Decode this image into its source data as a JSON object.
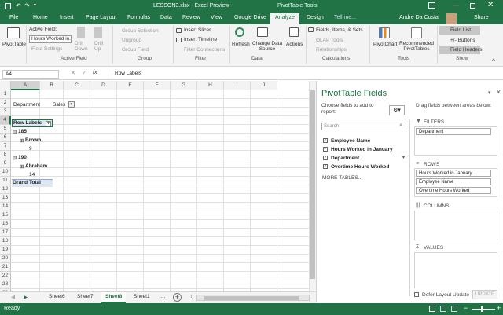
{
  "window": {
    "title": "LESSON3.xlsx - Excel Preview",
    "context_title": "PivotTable Tools",
    "user": "Andre Da Costa"
  },
  "tabs": [
    "File",
    "Home",
    "Insert",
    "Page Layout",
    "Formulas",
    "Data",
    "Review",
    "View",
    "Google Drive",
    "Analyze",
    "Design"
  ],
  "tell_me": "Tell me...",
  "share": "Share",
  "ribbon": {
    "pivottable": "PivotTable",
    "active_field_label": "Active Field:",
    "active_field_value": "Hours Worked in...",
    "field_settings": "Field Settings",
    "drill_down": "Drill Down",
    "drill_up": "Drill Up",
    "group_selection": "Group Selection",
    "ungroup": "Ungroup",
    "group_field": "Group Field",
    "insert_slicer": "Insert Slicer",
    "insert_timeline": "Insert Timeline",
    "filter_connections": "Filter Connections",
    "refresh": "Refresh",
    "change_data_source": "Change Data Source",
    "actions": "Actions",
    "fields_items_sets": "Fields, Items, & Sets",
    "olap_tools": "OLAP Tools",
    "relationships": "Relationships",
    "pivotchart": "PivotChart",
    "recommended": "Recommended PivotTables",
    "field_list": "Field List",
    "buttons": "+/- Buttons",
    "field_headers": "Field Headers",
    "groups": [
      "Active Field",
      "Group",
      "Filter",
      "Data",
      "Calculations",
      "Tools",
      "Show"
    ]
  },
  "formula": {
    "namebox": "A4",
    "fx": "fx",
    "value": "Row Labels"
  },
  "columns": [
    "A",
    "B",
    "C",
    "D",
    "E",
    "F",
    "G",
    "H",
    "I",
    "J"
  ],
  "rows": [
    "1",
    "2",
    "3",
    "4",
    "5",
    "6",
    "7",
    "8",
    "9",
    "10",
    "11",
    "12",
    "13",
    "14",
    "15",
    "16",
    "17",
    "18",
    "19",
    "20",
    "21",
    "22",
    "23",
    "24"
  ],
  "cells": {
    "department": "Department",
    "sales": "Sales",
    "row_labels": "Row Labels",
    "r185": "185",
    "brown": "Brown",
    "nine": "9",
    "r190": "190",
    "abraham": "Abraham",
    "fourteen": "14",
    "grand_total": "Grand Total"
  },
  "pane": {
    "title": "PivotTable Fields",
    "choose": "Choose fields to add to report:",
    "drag": "Drag fields between areas below:",
    "search": "Search",
    "fields": [
      {
        "label": "Employee Name",
        "checked": true
      },
      {
        "label": "Hours Worked in January",
        "checked": true
      },
      {
        "label": "Department",
        "checked": true
      },
      {
        "label": "Overtime Hours Worked",
        "checked": true
      }
    ],
    "more_tables": "MORE TABLES...",
    "filters_label": "FILTERS",
    "filters": [
      "Department"
    ],
    "rows_label": "ROWS",
    "rows": [
      "Hours Worked in January",
      "Employee Name",
      "Overtime Hours Worked"
    ],
    "columns_label": "COLUMNS",
    "values_label": "VALUES",
    "defer": "Defer Layout Update",
    "update": "UPDATE"
  },
  "sheets": [
    "Sheet6",
    "Sheet7",
    "Sheet8",
    "Sheet1"
  ],
  "active_sheet": "Sheet8",
  "status": "Ready"
}
